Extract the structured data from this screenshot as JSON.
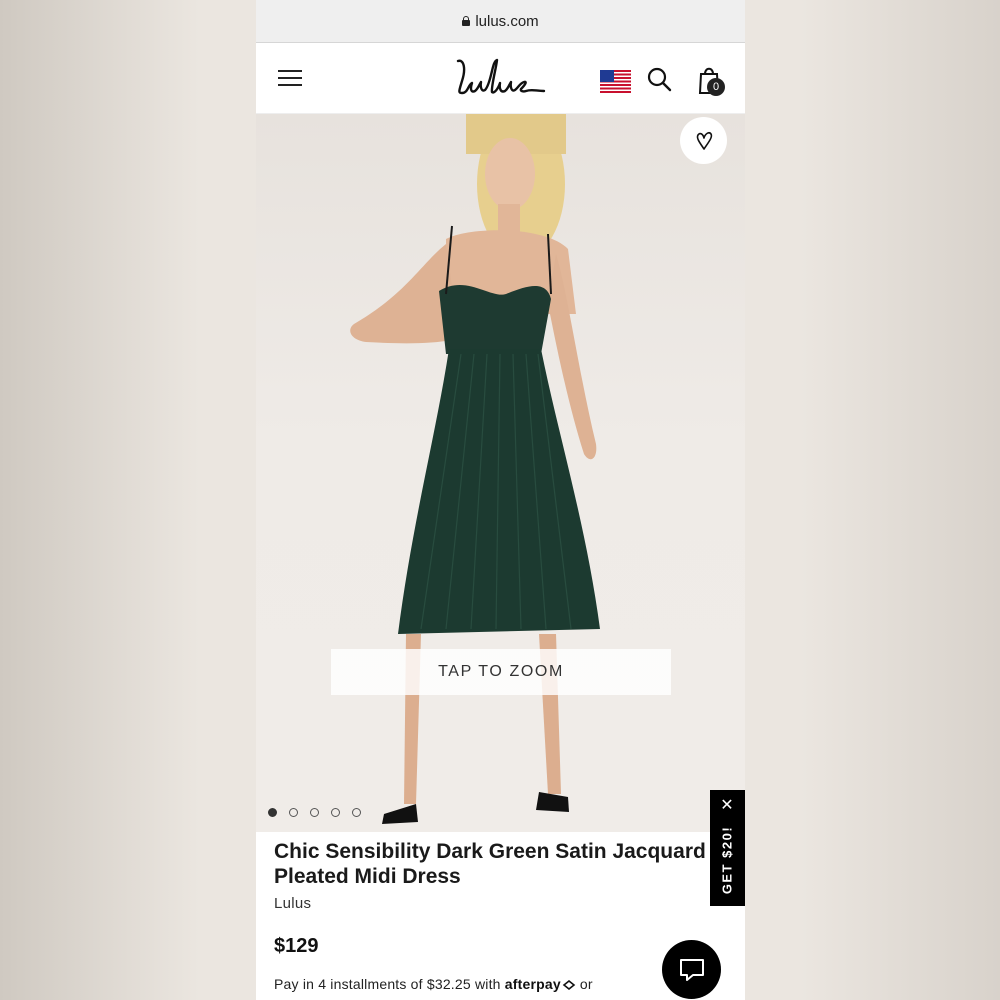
{
  "browser": {
    "url": "lulus.com"
  },
  "header": {
    "logo_text": "Lulus",
    "cart_count": "0"
  },
  "gallery": {
    "zoom_label": "TAP TO ZOOM",
    "dot_count": 5,
    "active_dot": 0
  },
  "promo": {
    "label": "GET $20!",
    "close_glyph": "✕"
  },
  "product": {
    "title": "Chic Sensibility Dark Green Satin Jacquard Pleated Midi Dress",
    "brand": "Lulus",
    "price": "$129"
  },
  "payment": {
    "installments_text": "Pay in 4 installments of $32.25 with",
    "provider": "afterpay",
    "suffix": "or"
  },
  "icons": [
    "lock-icon",
    "hamburger-icon",
    "us-flag-icon",
    "search-icon",
    "shopping-bag-icon",
    "heart-icon",
    "close-icon",
    "chat-icon"
  ],
  "colors": {
    "dress": "#1f3d33",
    "accent": "#000000",
    "header_bg": "#ffffff"
  }
}
